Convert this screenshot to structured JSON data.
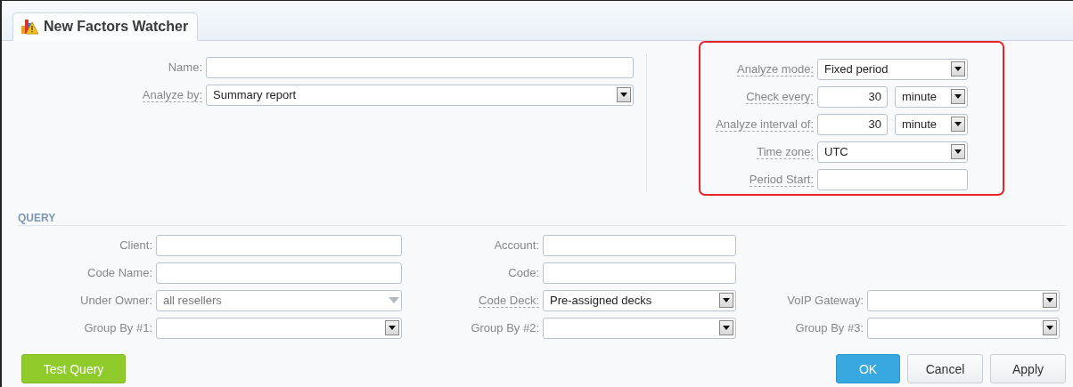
{
  "tab": {
    "title": "New Factors Watcher"
  },
  "general": [
    {
      "label": "Name:",
      "kind": "text",
      "help": false
    },
    {
      "label": "Analyze by:",
      "kind": "select",
      "help": true,
      "value": "Summary report"
    }
  ],
  "schedule": {
    "highlighted": true,
    "fields": [
      {
        "label": "Analyze mode:",
        "kind": "select",
        "help": true,
        "value": "Fixed period"
      },
      {
        "label": "Check every:",
        "kind": "number-unit",
        "help": true,
        "value": "30",
        "unit": "minute"
      },
      {
        "label": "Analyze interval of:",
        "kind": "number-unit",
        "help": true,
        "value": "30",
        "unit": "minute"
      },
      {
        "label": "Time zone:",
        "kind": "select",
        "help": true,
        "value": "UTC"
      },
      {
        "label": "Period Start:",
        "kind": "text",
        "help": true
      }
    ]
  },
  "query": {
    "title": "QUERY",
    "rows": [
      [
        {
          "label": "Client:",
          "kind": "text",
          "help": false
        },
        {
          "label": "Account:",
          "kind": "text",
          "help": false
        }
      ],
      [
        {
          "label": "Code Name:",
          "kind": "text",
          "help": false
        },
        {
          "label": "Code:",
          "kind": "text",
          "help": false
        }
      ],
      [
        {
          "label": "Under Owner:",
          "kind": "combo",
          "help": false,
          "value": "all resellers"
        },
        {
          "label": "Code Deck:",
          "kind": "select",
          "help": true,
          "value": "Pre-assigned decks"
        },
        {
          "label": "VoIP Gateway:",
          "kind": "select",
          "help": false
        }
      ],
      [
        {
          "label": "Group By #1:",
          "kind": "select",
          "help": false
        },
        {
          "label": "Group By #2:",
          "kind": "select",
          "help": false
        },
        {
          "label": "Group By #3:",
          "kind": "select",
          "help": false
        }
      ]
    ]
  },
  "buttons": [
    {
      "label": "Test Query",
      "kind": "success"
    },
    {
      "label": "OK",
      "kind": "primary"
    },
    {
      "label": "Cancel",
      "kind": "default"
    },
    {
      "label": "Apply",
      "kind": "default"
    }
  ]
}
